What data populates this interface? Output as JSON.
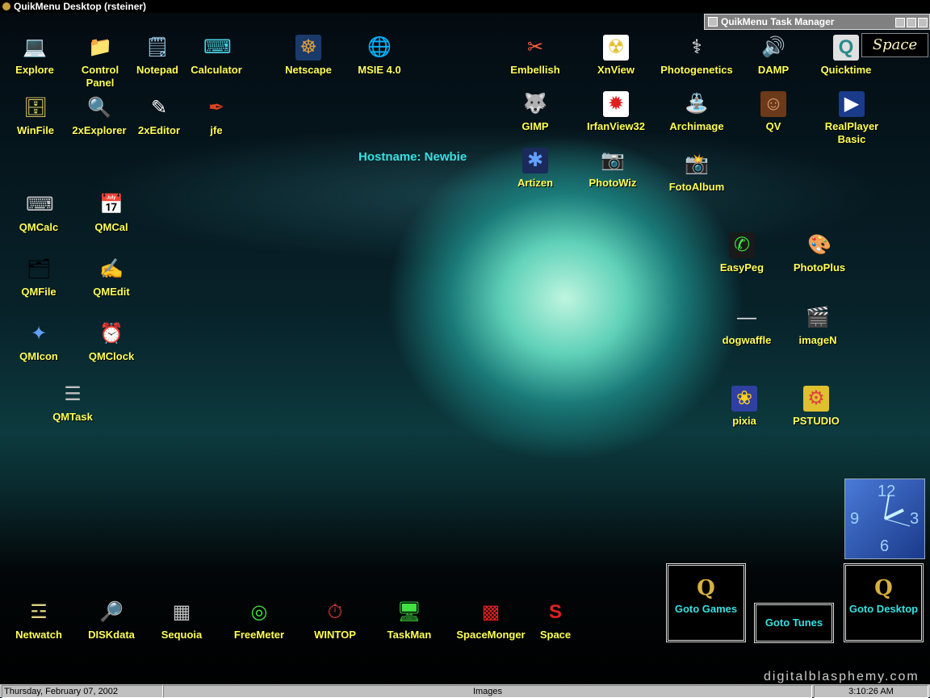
{
  "window_title": "QuikMenu Desktop (rsteiner)",
  "task_manager": {
    "title": "QuikMenu Task Manager"
  },
  "space_logo": "Space",
  "hostname": "Hostname: Newbie",
  "icons": {
    "explore": {
      "label": "Explore",
      "glyph": "💻"
    },
    "control_panel": {
      "label": "Control Panel",
      "glyph": "📁"
    },
    "notepad": {
      "label": "Notepad",
      "glyph": "🗒"
    },
    "calculator": {
      "label": "Calculator",
      "glyph": "⌨"
    },
    "netscape": {
      "label": "Netscape",
      "glyph": "☸"
    },
    "msie": {
      "label": "MSIE 4.0",
      "glyph": "🌐"
    },
    "winfile": {
      "label": "WinFile",
      "glyph": "🗄"
    },
    "twoxexplorer": {
      "label": "2xExplorer",
      "glyph": "🔍"
    },
    "twoxeditor": {
      "label": "2xEditor",
      "glyph": "✎"
    },
    "jfe": {
      "label": "jfe",
      "glyph": "✒"
    },
    "embellish": {
      "label": "Embellish",
      "glyph": "✂"
    },
    "xnview": {
      "label": "XnView",
      "glyph": "☢"
    },
    "photogenetics": {
      "label": "Photogenetics",
      "glyph": "⚕"
    },
    "damp": {
      "label": "DAMP",
      "glyph": "🔊"
    },
    "quicktime": {
      "label": "Quicktime",
      "glyph": "Q"
    },
    "gimp": {
      "label": "GIMP",
      "glyph": "🐺"
    },
    "irfanview": {
      "label": "IrfanView32",
      "glyph": "✹"
    },
    "archimage": {
      "label": "Archimage",
      "glyph": "⛲"
    },
    "qv": {
      "label": "QV",
      "glyph": "☺"
    },
    "realplayer": {
      "label": "RealPlayer Basic",
      "glyph": "▶"
    },
    "artizen": {
      "label": "Artizen",
      "glyph": "✱"
    },
    "photowiz": {
      "label": "PhotoWiz",
      "glyph": "📷"
    },
    "fotoalbum": {
      "label": "FotoAlbum",
      "glyph": "📸"
    },
    "qmcalc": {
      "label": "QMCalc",
      "glyph": "⌨"
    },
    "qmcal": {
      "label": "QMCal",
      "glyph": "📅"
    },
    "qmfile": {
      "label": "QMFile",
      "glyph": "🗂"
    },
    "qmedit": {
      "label": "QMEdit",
      "glyph": "✍"
    },
    "qmicon": {
      "label": "QMIcon",
      "glyph": "✦"
    },
    "qmclock": {
      "label": "QMClock",
      "glyph": "⏰"
    },
    "qmtask": {
      "label": "QMTask",
      "glyph": "☰"
    },
    "easypeg": {
      "label": "EasyPeg",
      "glyph": "✆"
    },
    "photoplus": {
      "label": "PhotoPlus",
      "glyph": "🎨"
    },
    "dogwaffle": {
      "label": "dogwaffle",
      "glyph": "—"
    },
    "imagen": {
      "label": "imageN",
      "glyph": "🎬"
    },
    "pixia": {
      "label": "pixia",
      "glyph": "❀"
    },
    "pstudio": {
      "label": "PSTUDIO",
      "glyph": "⚙"
    },
    "netwatch": {
      "label": "Netwatch",
      "glyph": "☲"
    },
    "diskdata": {
      "label": "DISKdata",
      "glyph": "🔎"
    },
    "sequoia": {
      "label": "Sequoia",
      "glyph": "▦"
    },
    "freemeter": {
      "label": "FreeMeter",
      "glyph": "◎"
    },
    "wintop": {
      "label": "WINTOP",
      "glyph": "⏱"
    },
    "taskman": {
      "label": "TaskMan",
      "glyph": "🖥"
    },
    "spacemonger": {
      "label": "SpaceMonger",
      "glyph": "▩"
    },
    "space": {
      "label": "Space",
      "glyph": "S"
    }
  },
  "clock": {
    "n12": "12",
    "n3": "3",
    "n6": "6",
    "n9": "9"
  },
  "goto": {
    "games": {
      "logo": "Q",
      "label": "Goto Games"
    },
    "tunes": {
      "label": "Goto Tunes"
    },
    "desktop": {
      "logo": "Q",
      "label": "Goto Desktop"
    }
  },
  "watermark": "digitalblasphemy.com",
  "status": {
    "date": "Thursday, February 07, 2002",
    "center": "Images",
    "time": "3:10:26 AM"
  }
}
